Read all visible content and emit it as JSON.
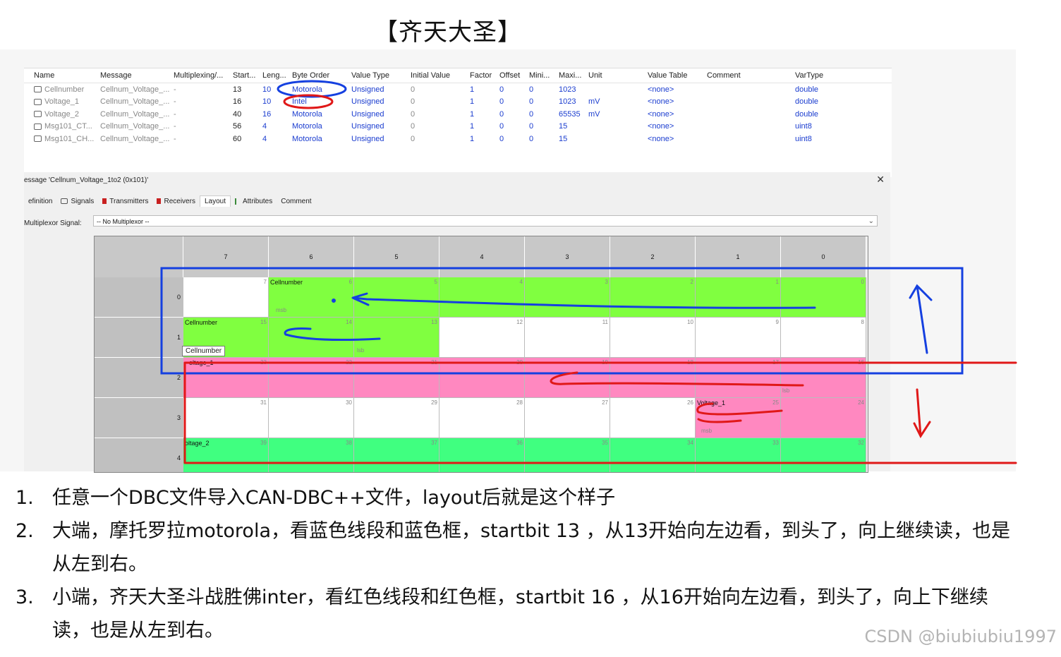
{
  "title": "【齐天大圣】",
  "signal_table": {
    "columns": [
      "Name",
      "Message",
      "Multiplexing/...",
      "Start...",
      "Leng...",
      "Byte Order",
      "Value Type",
      "Initial Value",
      "Factor",
      "Offset",
      "Mini...",
      "Maxi...",
      "Unit",
      "Value Table",
      "Comment",
      "VarType"
    ],
    "rows": [
      [
        "Cellnumber",
        "Cellnum_Voltage_...",
        "-",
        "13",
        "10",
        "Motorola",
        "Unsigned",
        "0",
        "1",
        "0",
        "0",
        "1023",
        "",
        "<none>",
        "",
        "double"
      ],
      [
        "Voltage_1",
        "Cellnum_Voltage_...",
        "-",
        "16",
        "10",
        "Intel",
        "Unsigned",
        "0",
        "1",
        "0",
        "0",
        "1023",
        "mV",
        "<none>",
        "",
        "double"
      ],
      [
        "Voltage_2",
        "Cellnum_Voltage_...",
        "-",
        "40",
        "16",
        "Motorola",
        "Unsigned",
        "0",
        "1",
        "0",
        "0",
        "65535",
        "mV",
        "<none>",
        "",
        "double"
      ],
      [
        "Msg101_CT...",
        "Cellnum_Voltage_...",
        "-",
        "56",
        "4",
        "Motorola",
        "Unsigned",
        "0",
        "1",
        "0",
        "0",
        "15",
        "",
        "<none>",
        "",
        "uint8"
      ],
      [
        "Msg101_CH...",
        "Cellnum_Voltage_...",
        "-",
        "60",
        "4",
        "Motorola",
        "Unsigned",
        "0",
        "1",
        "0",
        "0",
        "15",
        "",
        "<none>",
        "",
        "uint8"
      ]
    ]
  },
  "dialog": {
    "title": "essage 'Cellnum_Voltage_1to2 (0x101)'",
    "close": "✕",
    "tabs": [
      "efinition",
      "Signals",
      "Transmitters",
      "Receivers",
      "Layout",
      "Attributes",
      "Comment"
    ],
    "active_tab": "Layout",
    "multiplexor_label": "Multiplexor Signal:",
    "multiplexor_value": "-- No Multiplexor --"
  },
  "layout_grid": {
    "column_headers": [
      "7",
      "6",
      "5",
      "4",
      "3",
      "2",
      "1",
      "0"
    ],
    "row_headers": [
      "0",
      "1",
      "2",
      "3",
      "4"
    ],
    "bits": [
      [
        "7",
        "6",
        "5",
        "4",
        "3",
        "2",
        "1",
        "0"
      ],
      [
        "15",
        "14",
        "13",
        "12",
        "11",
        "10",
        "9",
        "8"
      ],
      [
        "23",
        "22",
        "21",
        "20",
        "19",
        "18",
        "17",
        "16"
      ],
      [
        "31",
        "30",
        "29",
        "28",
        "27",
        "26",
        "25",
        "24"
      ],
      [
        "39",
        "38",
        "37",
        "36",
        "35",
        "34",
        "33",
        "32"
      ]
    ],
    "signal_labels": {
      "cellnumber_row0": "Cellnumber",
      "cellnumber_row1": "Cellnumber",
      "voltage1_row2": "oltage_1",
      "voltage1_row3": "Voltage_1",
      "voltage2_row4": "oltage_2"
    },
    "tags": {
      "msb_row0": "msb",
      "lsb_row1": "lsb",
      "lsb_row2": "lsb",
      "msb_row3": "msb"
    },
    "tooltip": "Cellnumber",
    "colors": {
      "cellnumber": "#80ff40",
      "voltage1": "#ff88c0",
      "voltage2": "#40ff80"
    }
  },
  "annotations": {
    "blue": "#1540e0",
    "red": "#e01818"
  },
  "notes": [
    {
      "num": "1.",
      "text": "任意一个DBC文件导入CAN-DBC++文件，layout后就是这个样子"
    },
    {
      "num": "2.",
      "text": "大端，摩托罗拉motorola，看蓝色线段和蓝色框，startbit 13 ，从13开始向左边看，到头了，向上继续读，也是从左到右。"
    },
    {
      "num": "3.",
      "text": "小端，齐天大圣斗战胜佛inter，看红色线段和红色框，startbit 16 ，从16开始向左边看，到头了，向上下继续读，也是从左到右。"
    }
  ],
  "watermark": "CSDN @biubiubiu1997"
}
